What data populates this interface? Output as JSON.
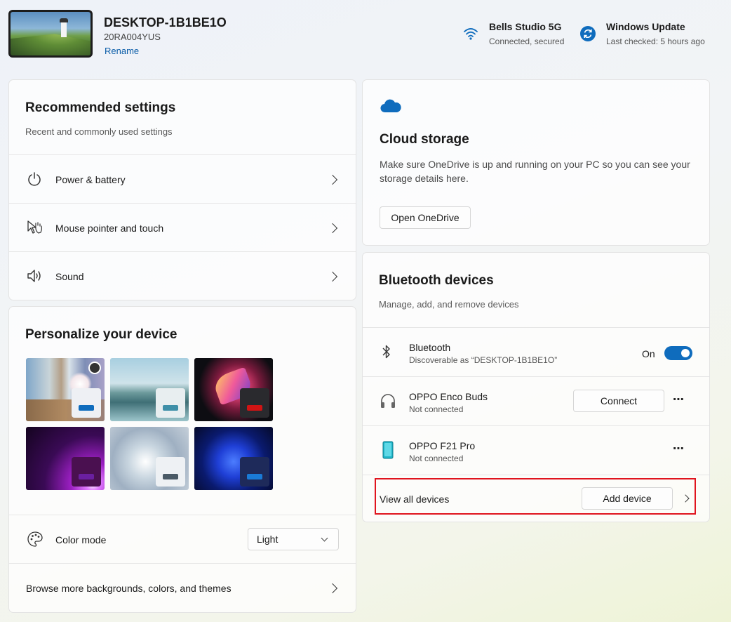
{
  "header": {
    "device_name": "DESKTOP-1B1BE1O",
    "device_model": "20RA004YUS",
    "rename_label": "Rename",
    "wifi": {
      "title": "Bells Studio 5G",
      "status": "Connected, secured",
      "icon": "wifi-icon"
    },
    "update": {
      "title": "Windows Update",
      "status": "Last checked: 5 hours ago",
      "icon": "sync-icon"
    }
  },
  "recommended": {
    "title": "Recommended settings",
    "subtitle": "Recent and commonly used settings",
    "items": [
      {
        "label": "Power & battery",
        "icon": "power-icon"
      },
      {
        "label": "Mouse pointer and touch",
        "icon": "mouse-pointer-icon"
      },
      {
        "label": "Sound",
        "icon": "speaker-icon"
      }
    ]
  },
  "personalize": {
    "title": "Personalize your device",
    "color_mode_label": "Color mode",
    "color_mode_value": "Light",
    "browse_label": "Browse more backgrounds, colors, and themes"
  },
  "cloud": {
    "title": "Cloud storage",
    "description": "Make sure OneDrive is up and running on your PC so you can see your storage details here.",
    "button_label": "Open OneDrive",
    "icon": "cloud-icon"
  },
  "bluetooth": {
    "title": "Bluetooth devices",
    "subtitle": "Manage, add, and remove devices",
    "toggle_row": {
      "name": "Bluetooth",
      "status": "Discoverable as “DESKTOP-1B1BE1O”",
      "state": "On"
    },
    "devices": [
      {
        "name": "OPPO Enco Buds",
        "status": "Not connected",
        "action": "Connect",
        "icon": "headphones-icon"
      },
      {
        "name": "OPPO F21 Pro",
        "status": "Not connected",
        "icon": "phone-icon"
      }
    ],
    "more_label": "⋯",
    "view_all_label": "View all devices",
    "add_device_label": "Add device"
  },
  "colors": {
    "accent": "#0f6cbd",
    "highlight": "#e0141e"
  }
}
